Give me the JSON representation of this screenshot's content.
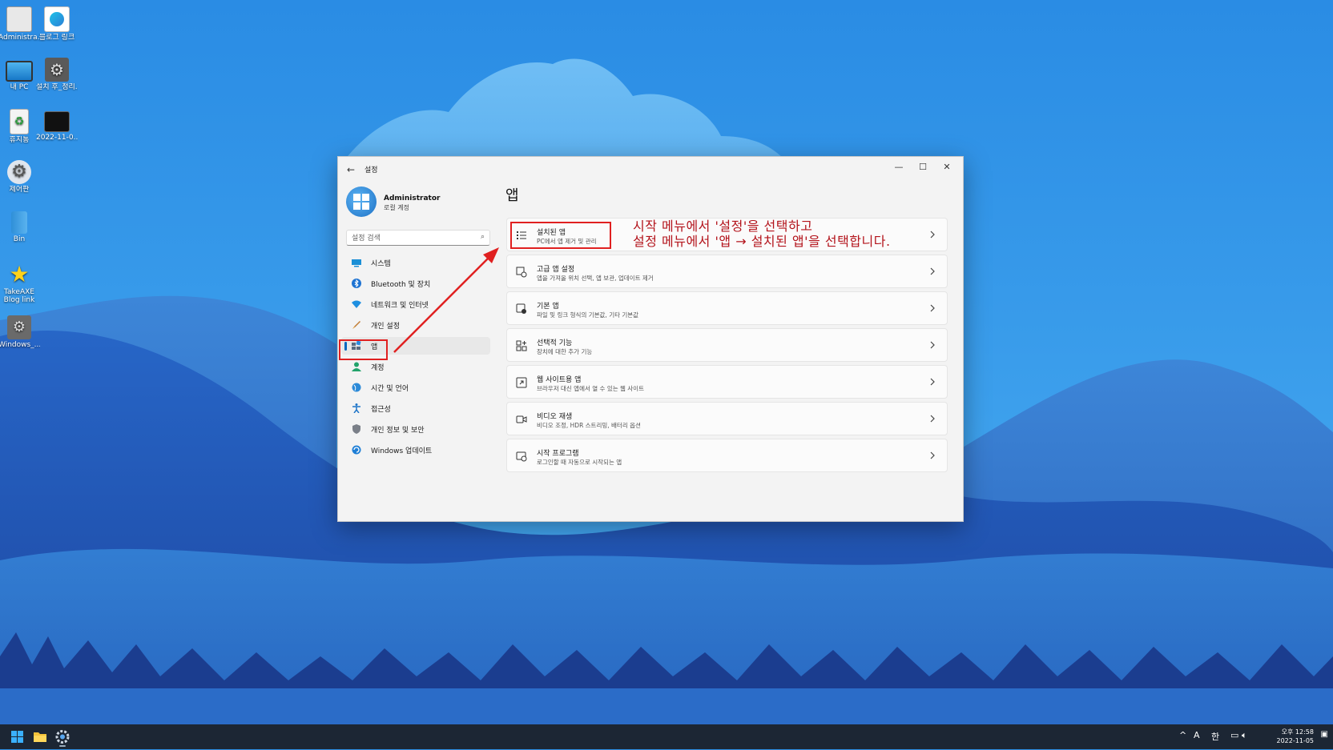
{
  "desktop": {
    "icons": [
      {
        "label": "Administra..."
      },
      {
        "label": "블로그 링크"
      },
      {
        "label": "내 PC"
      },
      {
        "label": "설치 후_정리..."
      },
      {
        "label": "휴지통"
      },
      {
        "label": "2022-11-0..."
      },
      {
        "label": "제어판"
      },
      {
        "label": "Bin"
      },
      {
        "label": "TakeAXE Blog link"
      },
      {
        "label": "Windows_..."
      }
    ]
  },
  "window": {
    "title": "설정",
    "user": {
      "name": "Administrator",
      "account_type": "로컬 계정"
    },
    "search": {
      "placeholder": "설정 검색"
    },
    "nav": [
      {
        "label": "시스템",
        "icon": "monitor-icon"
      },
      {
        "label": "Bluetooth 및 장치",
        "icon": "bluetooth-icon"
      },
      {
        "label": "네트워크 및 인터넷",
        "icon": "wifi-icon"
      },
      {
        "label": "개인 설정",
        "icon": "brush-icon"
      },
      {
        "label": "앱",
        "icon": "apps-icon",
        "selected": true
      },
      {
        "label": "계정",
        "icon": "person-icon"
      },
      {
        "label": "시간 및 언어",
        "icon": "globe-icon"
      },
      {
        "label": "접근성",
        "icon": "accessibility-icon"
      },
      {
        "label": "개인 정보 및 보안",
        "icon": "shield-icon"
      },
      {
        "label": "Windows 업데이트",
        "icon": "update-icon"
      }
    ],
    "page_title": "앱",
    "cards": [
      {
        "title": "설치된 앱",
        "subtitle": "PC에서 앱 제거 및 관리",
        "icon": "list-icon"
      },
      {
        "title": "고급 앱 설정",
        "subtitle": "앱을 가져올 위치 선택, 앱 보관, 업데이트 제거",
        "icon": "app-settings-icon"
      },
      {
        "title": "기본 앱",
        "subtitle": "파일 및 링크 형식의 기본값, 기타 기본값",
        "icon": "default-apps-icon"
      },
      {
        "title": "선택적 기능",
        "subtitle": "장치에 대한 추가 기능",
        "icon": "optional-features-icon"
      },
      {
        "title": "웹 사이트용 앱",
        "subtitle": "브라우저 대신 앱에서 열 수 있는 웹 사이트",
        "icon": "web-apps-icon"
      },
      {
        "title": "비디오 재생",
        "subtitle": "비디오 조정, HDR 스트리밍, 배터리 옵션",
        "icon": "video-icon"
      },
      {
        "title": "시작 프로그램",
        "subtitle": "로그인할 때 자동으로 시작되는 앱",
        "icon": "startup-icon"
      }
    ]
  },
  "annotation": {
    "line1": "시작 메뉴에서 '설정'을 선택하고",
    "line2": "설정 메뉴에서 '앱 → 설치된 앱'을 선택합니다.",
    "color": "#b3131b"
  },
  "taskbar": {
    "tray_chevron": "^",
    "tray_lang_a": "A",
    "tray_ime": "한",
    "clock_time": "오후 12:58",
    "clock_date": "2022-11-05"
  },
  "colors": {
    "accent": "#0067c0",
    "highlight_box": "#e02020"
  }
}
